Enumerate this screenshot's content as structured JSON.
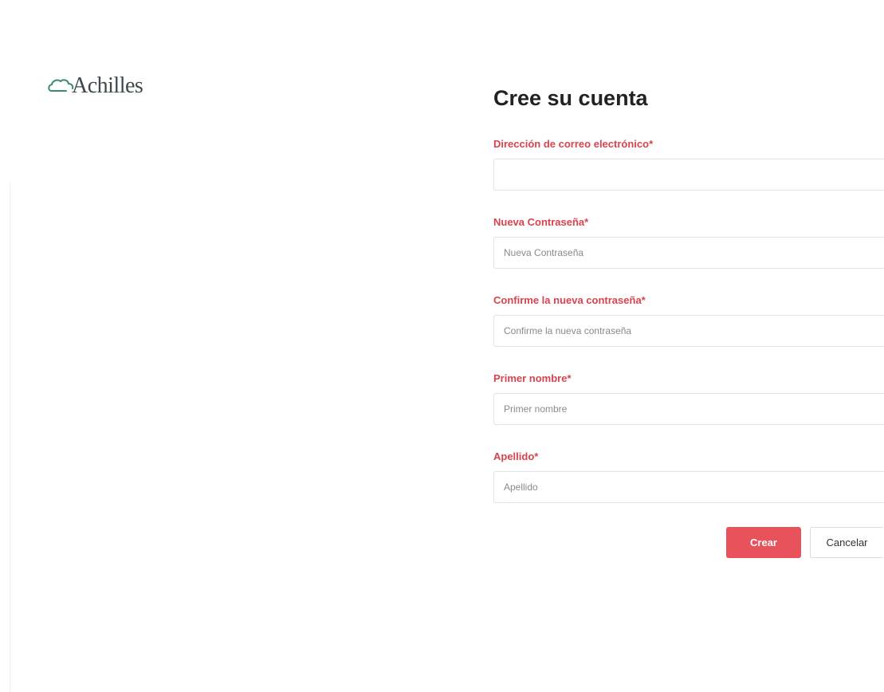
{
  "brand": {
    "name": "Achilles",
    "color": "#3d8a70"
  },
  "form": {
    "title": "Cree su cuenta",
    "fields": [
      {
        "label": "Dirección de correo electrónico*",
        "placeholder": "",
        "value": ""
      },
      {
        "label": "Nueva Contraseña*",
        "placeholder": "Nueva Contraseña",
        "value": ""
      },
      {
        "label": "Confirme la nueva contraseña*",
        "placeholder": "Confirme la nueva contraseña",
        "value": ""
      },
      {
        "label": "Primer nombre*",
        "placeholder": "Primer nombre",
        "value": ""
      },
      {
        "label": "Apellido*",
        "placeholder": "Apellido",
        "value": ""
      }
    ],
    "submit_label": "Crear",
    "cancel_label": "Cancelar"
  },
  "colors": {
    "label": "#d9424f",
    "primary_button": "#e8525a"
  }
}
